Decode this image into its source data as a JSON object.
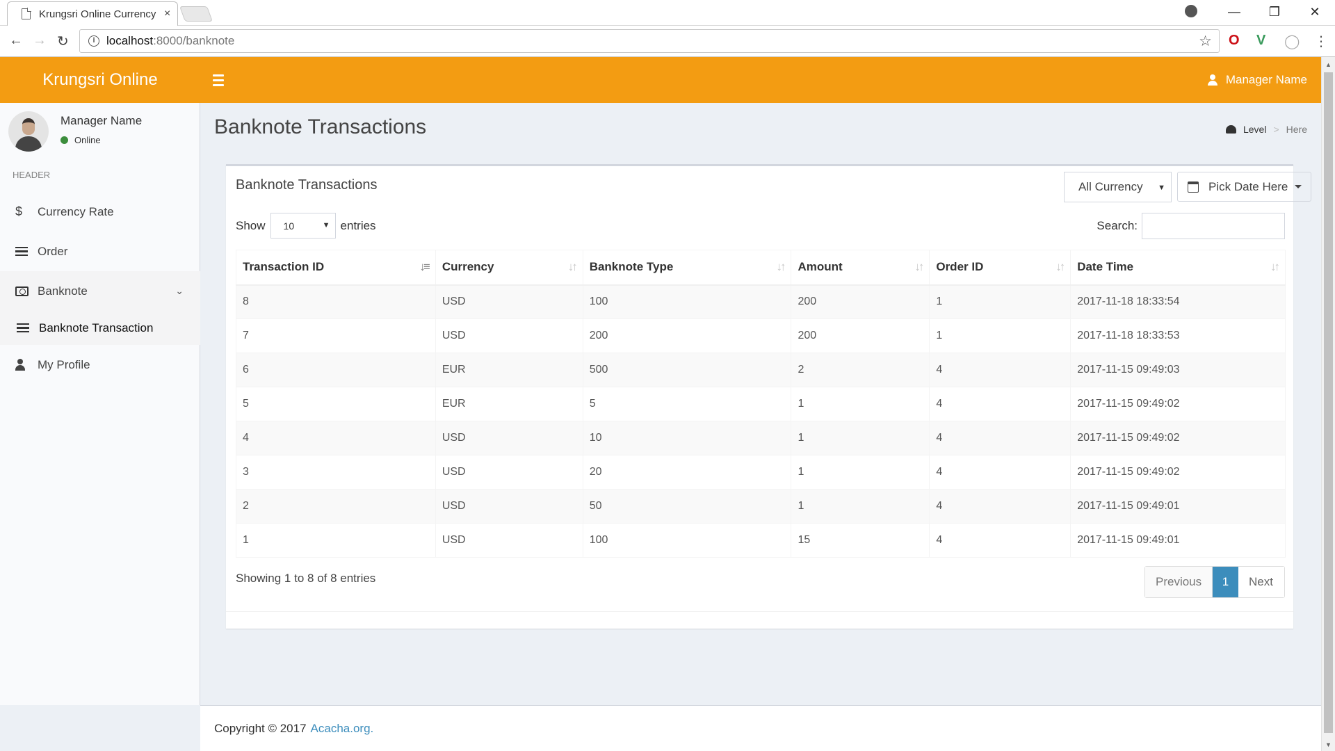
{
  "browser": {
    "tab_title": "Krungsri Online Currency",
    "tab_close": "×",
    "url_host": "localhost",
    "url_path": ":8000/banknote",
    "controls": {
      "minimize": "—",
      "restore": "❐",
      "close": "✕"
    }
  },
  "header": {
    "logo": "Krungsri Online",
    "user_name": "Manager Name",
    "accent_color": "#f39c12"
  },
  "sidebar": {
    "user_name": "Manager Name",
    "status": "Online",
    "section_header": "HEADER",
    "items": [
      {
        "label": "Currency Rate",
        "icon": "dollar-icon"
      },
      {
        "label": "Order",
        "icon": "list-icon"
      },
      {
        "label": "Banknote",
        "icon": "money-icon"
      },
      {
        "label": "Banknote Transaction",
        "icon": "list-icon"
      },
      {
        "label": "My Profile",
        "icon": "user-icon"
      }
    ]
  },
  "content": {
    "title": "Banknote Transactions",
    "breadcrumb": {
      "level": "Level",
      "here": "Here"
    }
  },
  "box": {
    "title": "Banknote Transactions",
    "currency_filter": "All Currency",
    "date_picker": "Pick Date Here",
    "length": {
      "show": "Show",
      "value": "10",
      "entries": "entries"
    },
    "search_label": "Search:",
    "columns": [
      "Transaction ID",
      "Currency",
      "Banknote Type",
      "Amount",
      "Order ID",
      "Date Time"
    ],
    "rows": [
      [
        "8",
        "USD",
        "100",
        "200",
        "1",
        "2017-11-18 18:33:54"
      ],
      [
        "7",
        "USD",
        "200",
        "200",
        "1",
        "2017-11-18 18:33:53"
      ],
      [
        "6",
        "EUR",
        "500",
        "2",
        "4",
        "2017-11-15 09:49:03"
      ],
      [
        "5",
        "EUR",
        "5",
        "1",
        "4",
        "2017-11-15 09:49:02"
      ],
      [
        "4",
        "USD",
        "10",
        "1",
        "4",
        "2017-11-15 09:49:02"
      ],
      [
        "3",
        "USD",
        "20",
        "1",
        "4",
        "2017-11-15 09:49:02"
      ],
      [
        "2",
        "USD",
        "50",
        "1",
        "4",
        "2017-11-15 09:49:01"
      ],
      [
        "1",
        "USD",
        "100",
        "15",
        "4",
        "2017-11-15 09:49:01"
      ]
    ],
    "info": "Showing 1 to 8 of 8 entries",
    "pagination": {
      "previous": "Previous",
      "current": "1",
      "next": "Next"
    }
  },
  "footer": {
    "text": "Copyright © 2017",
    "org": "Acacha.org."
  }
}
